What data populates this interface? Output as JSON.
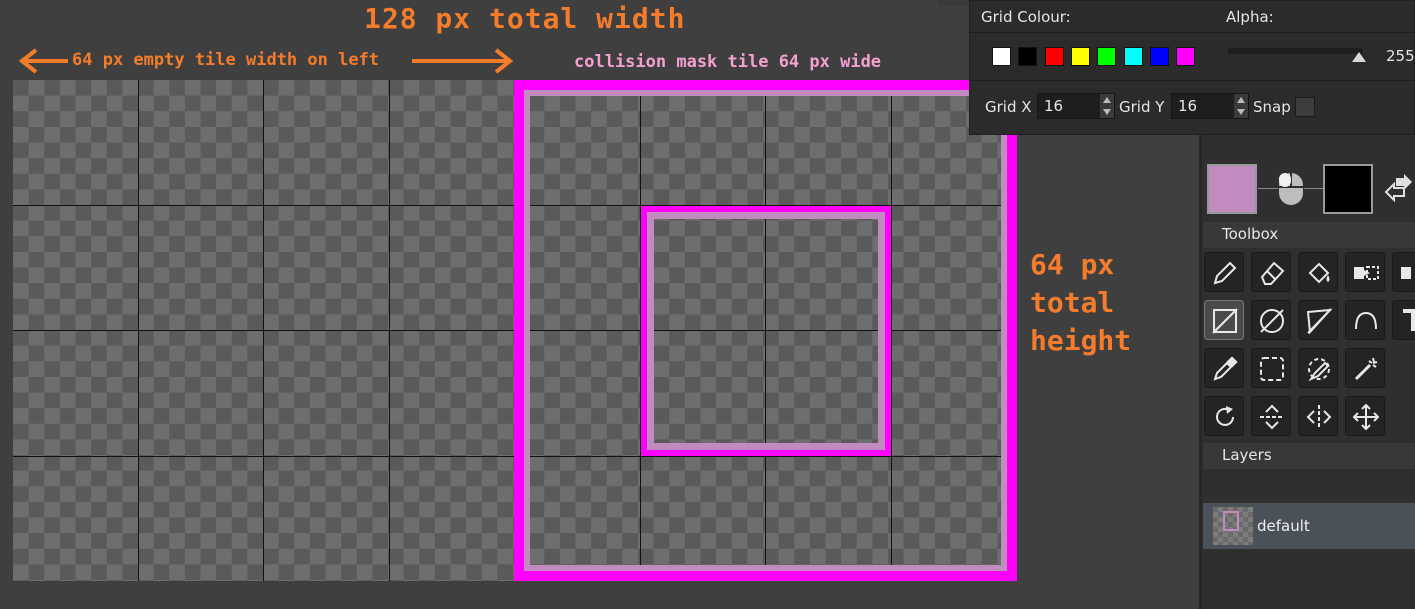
{
  "annotations": {
    "total_width": "128 px total width",
    "left_empty": "64 px empty tile width on left",
    "mask_tile": "collision mask tile 64 px wide",
    "total_height": "64 px\ntotal\nheight"
  },
  "grid_popup": {
    "grid_colour_label": "Grid Colour:",
    "alpha_label": "Alpha:",
    "alpha_value": "255",
    "colour_swatches": [
      "#ffffff",
      "#000000",
      "#ff0000",
      "#ffff00",
      "#00ff00",
      "#00ffff",
      "#0000ff",
      "#ff00ff"
    ],
    "grid_x_label": "Grid X",
    "grid_x_value": "16",
    "grid_y_label": "Grid Y",
    "grid_y_value": "16",
    "snap_label": "Snap"
  },
  "colors": {
    "primary": "#c28bc0",
    "secondary": "#000000",
    "mask_magenta": "#ff00ff",
    "annotation_orange": "#f47c2a"
  },
  "toolbox": {
    "title": "Toolbox",
    "tools": [
      "pencil-icon",
      "eraser-icon",
      "fill-bucket-icon",
      "selection-transfer-icon",
      "selection-transfer-partial-icon",
      "rectangle-icon",
      "ellipse-icon",
      "line-icon",
      "arc-icon",
      "text-icon",
      "eyedropper-icon",
      "rect-select-icon",
      "lasso-select-icon",
      "magic-wand-icon",
      "rotate-icon",
      "flip-vertical-icon",
      "flip-horizontal-icon",
      "move-icon"
    ]
  },
  "layers": {
    "title": "Layers",
    "items": [
      {
        "name": "default"
      }
    ]
  }
}
